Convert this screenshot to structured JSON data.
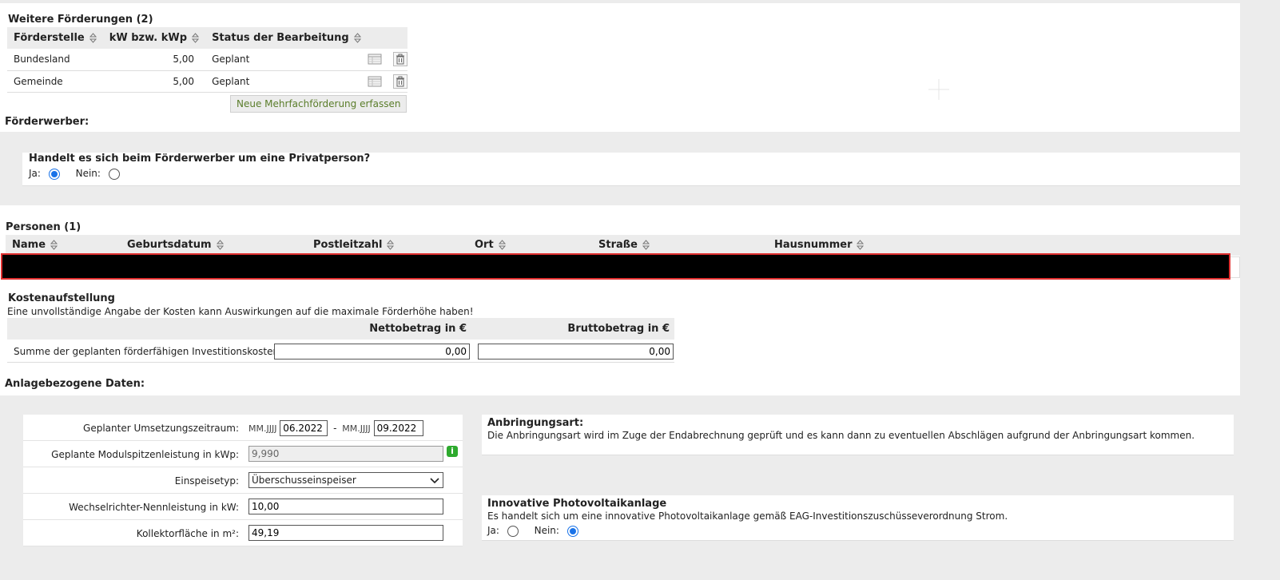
{
  "weitere": {
    "title": "Weitere Förderungen (2)",
    "columns": [
      "Förderstelle",
      "kW bzw. kWp",
      "Status der Bearbeitung"
    ],
    "rows": [
      {
        "stelle": "Bundesland",
        "kw": "5,00",
        "status": "Geplant"
      },
      {
        "stelle": "Gemeinde",
        "kw": "5,00",
        "status": "Geplant"
      }
    ],
    "new_button": "Neue Mehrfachförderung erfassen"
  },
  "foerderwerber": {
    "title": "Förderwerber:",
    "question": "Handelt es sich beim Förderwerber um eine Privatperson?",
    "ja_label": "Ja:",
    "nein_label": "Nein:",
    "selected": "ja"
  },
  "personen": {
    "title": "Personen (1)",
    "columns": [
      "Name",
      "Geburtsdatum",
      "Postleitzahl",
      "Ort",
      "Straße",
      "Hausnummer"
    ]
  },
  "kosten": {
    "title": "Kostenaufstellung",
    "note": "Eine unvollständige Angabe der Kosten kann Auswirkungen auf die maximale Förderhöhe haben!",
    "col_netto": "Nettobetrag in €",
    "col_brutto": "Bruttobetrag in €",
    "row_label": "Summe der geplanten förderfähigen Investitionskosten",
    "netto_value": "0,00",
    "brutto_value": "0,00"
  },
  "anlage": {
    "title": "Anlagebezogene Daten:",
    "umsetzung_label": "Geplanter Umsetzungszeitraum:",
    "date_format": "MM.JJJJ",
    "date_from": "06.2022",
    "date_sep": "-",
    "date_to": "09.2022",
    "modul_label": "Geplante Modulspitzenleistung in kWp:",
    "modul_value": "9,990",
    "einspeise_label": "Einspeisetyp:",
    "einspeise_value": "Überschusseinspeiser",
    "wechsel_label": "Wechselrichter-Nennleistung in kW:",
    "wechsel_value": "10,00",
    "kollektor_label": "Kollektorfläche in m²:",
    "kollektor_value": "49,19"
  },
  "anbringung": {
    "title": "Anbringungsart:",
    "text": "Die Anbringungsart wird im Zuge der Endabrechnung geprüft und es kann dann zu eventuellen Abschlägen aufgrund der Anbringungsart kommen."
  },
  "innovativ": {
    "title": "Innovative Photovoltaikanlage",
    "text": "Es handelt sich um eine innovative Photovoltaikanlage gemäß EAG-Investitionszuschüsseverordnung Strom.",
    "ja_label": "Ja:",
    "nein_label": "Nein:",
    "selected": "nein"
  },
  "colors": {
    "accent": "#1a73e8",
    "button_text": "#5a7d2a",
    "redaction": "#000000",
    "redaction_border": "#e03030",
    "info_icon": "#2eaa2e"
  }
}
